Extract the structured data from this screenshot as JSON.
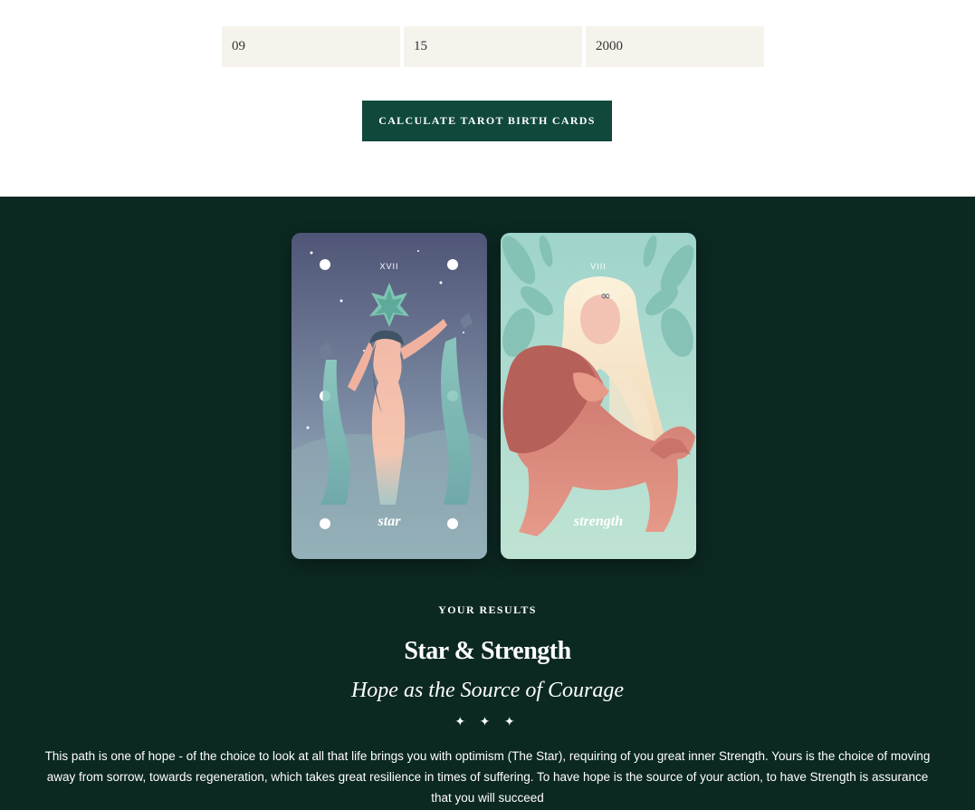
{
  "form": {
    "month_value": "09",
    "day_value": "15",
    "year_value": "2000",
    "calculate_label": "Calculate Tarot Birth Cards"
  },
  "cards": [
    {
      "numeral": "XVII",
      "name": "star"
    },
    {
      "numeral": "VIII",
      "name": "strength"
    }
  ],
  "results": {
    "kicker": "YOUR RESULTS",
    "title": "Star & Strength",
    "subtitle": "Hope as the Source of Courage",
    "ornament": "✦ ✦ ✦",
    "description": "This path is one of hope - of the choice to look at all that life brings you with optimism (The Star), requiring of you great inner Strength. Yours is the choice of moving away from sorrow, towards regeneration, which takes great resilience in times of suffering. To have hope is the source of your action, to have Strength is assurance that you will succeed"
  },
  "colors": {
    "button_bg": "#10483c",
    "results_bg": "#0c2822",
    "field_bg": "#f6f3ec"
  }
}
